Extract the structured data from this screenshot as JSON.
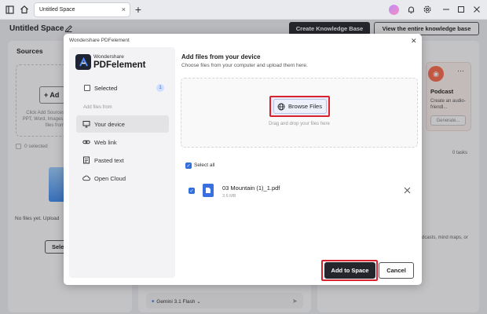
{
  "titlebar": {
    "tab_label": "Untitled Space",
    "tab_close": "×",
    "new_tab": "+"
  },
  "header": {
    "space_title": "Untitled Space",
    "create_kb_label": "Create Knowledge Base",
    "view_kb_label": "View the entire knowledge base"
  },
  "background": {
    "sources_title": "Sources",
    "add_label": "+ Ad",
    "sources_hint": "Click Add Sources\nPPT, Word, Images,\nfiles from",
    "selected_count": "0 selected",
    "no_files_text": "No files yet. Upload",
    "select_btn": "Sele",
    "podcast_title": "Podcast",
    "podcast_desc": "Create an audio-friendl...",
    "generate_btn": "Generate...",
    "tasks_count": "0 tasks",
    "podcast_hint": "dcasts, mind maps, or",
    "model_label": "Gemini 3.1 Flash"
  },
  "dialog": {
    "window_title": "Wondershare PDFelement",
    "brand_top": "Wondershare",
    "brand_name": "PDFelement",
    "selected_label": "Selected",
    "selected_badge": "1",
    "add_from_label": "Add files from",
    "nav": [
      {
        "label": "Your device",
        "icon": "monitor-icon"
      },
      {
        "label": "Web link",
        "icon": "link-icon"
      },
      {
        "label": "Pasted text",
        "icon": "text-icon"
      },
      {
        "label": "Open Cloud",
        "icon": "cloud-icon"
      }
    ],
    "heading": "Add files from your device",
    "subheading": "Choose files from your computer and upload them here.",
    "browse_label": "Browse Files",
    "drag_hint": "Drag and drop your files here",
    "select_all_label": "Select all",
    "file": {
      "name": "03 Mountain (1)_1.pdf",
      "size": "3.6 MB"
    },
    "add_button": "Add to Space",
    "cancel_button": "Cancel"
  },
  "colors": {
    "accent": "#2f6fde",
    "highlight": "#d9232e",
    "primary_dark": "#25262b"
  }
}
